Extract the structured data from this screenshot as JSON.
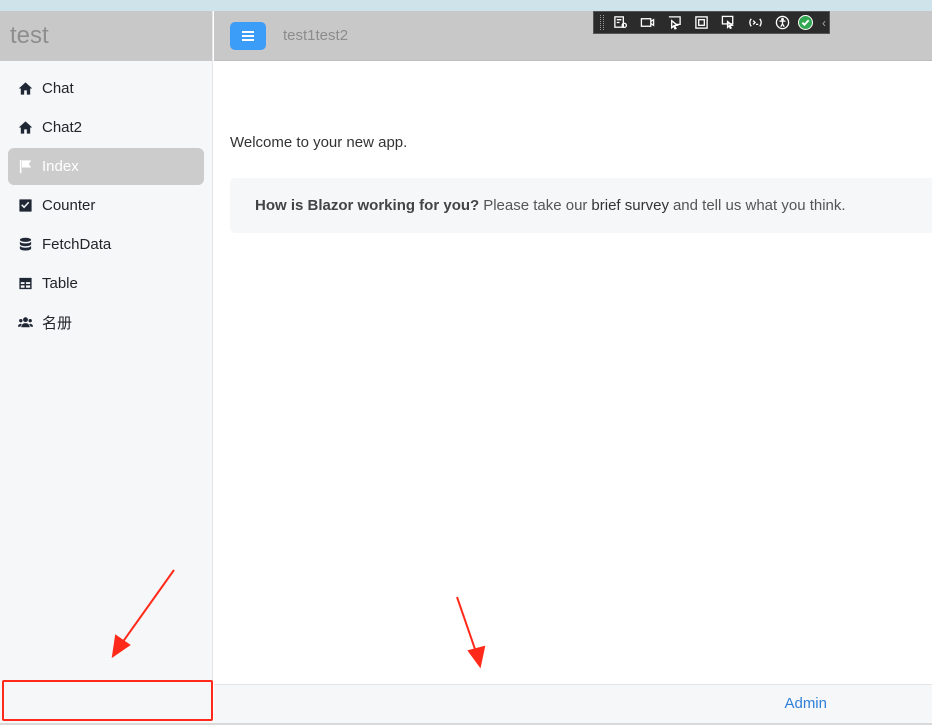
{
  "app": {
    "brand": "test",
    "header_title": "test1test2"
  },
  "sidebar": {
    "items": [
      {
        "label": "Chat",
        "icon": "home-icon",
        "active": false
      },
      {
        "label": "Chat2",
        "icon": "home-icon",
        "active": false
      },
      {
        "label": "Index",
        "icon": "flag-icon",
        "active": true
      },
      {
        "label": "Counter",
        "icon": "check-square-icon",
        "active": false
      },
      {
        "label": "FetchData",
        "icon": "database-icon",
        "active": false
      },
      {
        "label": "Table",
        "icon": "table-icon",
        "active": false
      },
      {
        "label": "名册",
        "icon": "users-icon",
        "active": false
      }
    ]
  },
  "main": {
    "welcome": "Welcome to your new app.",
    "survey": {
      "question": "How is Blazor working for you?",
      "text_before": "Please take our",
      "link": "brief survey",
      "text_after": "and tell us what you think."
    }
  },
  "footer": {
    "admin_link": "Admin"
  },
  "devtools": {
    "buttons": [
      "go-to-live-visual-tree-icon",
      "select-element-icon",
      "display-layout-adorners-icon",
      "track-focus-icon",
      "binding-failures-icon",
      "hot-reload-icon",
      "accessibility-icon"
    ],
    "status": "ok-check-icon"
  },
  "colors": {
    "accent": "#3b9df7",
    "active_item": "#cccccc",
    "header": "#c8c8c8",
    "link": "#2f7fd8",
    "annotation": "#ff2a1a"
  }
}
